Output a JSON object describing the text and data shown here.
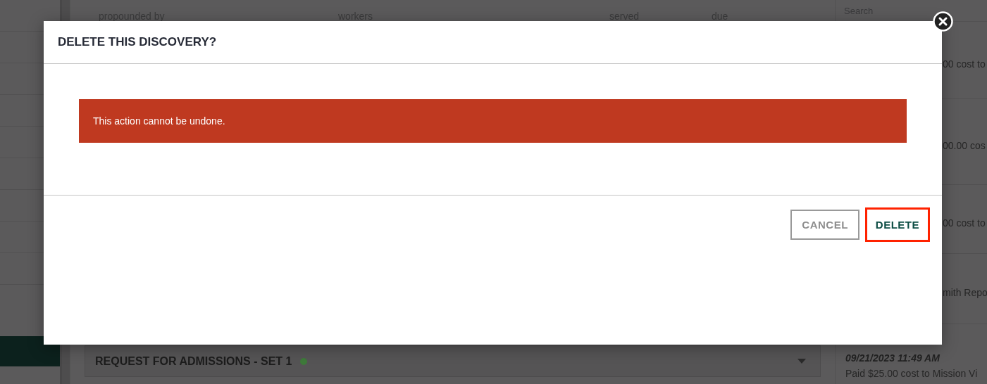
{
  "background": {
    "table_headers": [
      "propounded by",
      "workers",
      "served",
      "due"
    ],
    "section": {
      "title": "REQUEST FOR ADMISSIONS - SET 1",
      "color": "#3e7a3a"
    },
    "search": {
      "placeholder": "Search"
    },
    "activity": [
      {
        "text": "00 cost to"
      },
      {
        "text": "00.00 cos"
      },
      {
        "text": "00 cost to"
      },
      {
        "text": "mith Repo"
      }
    ],
    "last_entry": {
      "time": "09/21/2023 11:49 AM",
      "text": "Paid $25.00 cost to Mission Vi"
    }
  },
  "modal": {
    "title": "DELETE THIS DISCOVERY?",
    "message": "This action cannot be undone.",
    "buttons": [
      {
        "label": "CANCEL",
        "kind": "secondary",
        "highlighted": false
      },
      {
        "label": "DELETE",
        "kind": "primary",
        "highlighted": true
      }
    ]
  }
}
